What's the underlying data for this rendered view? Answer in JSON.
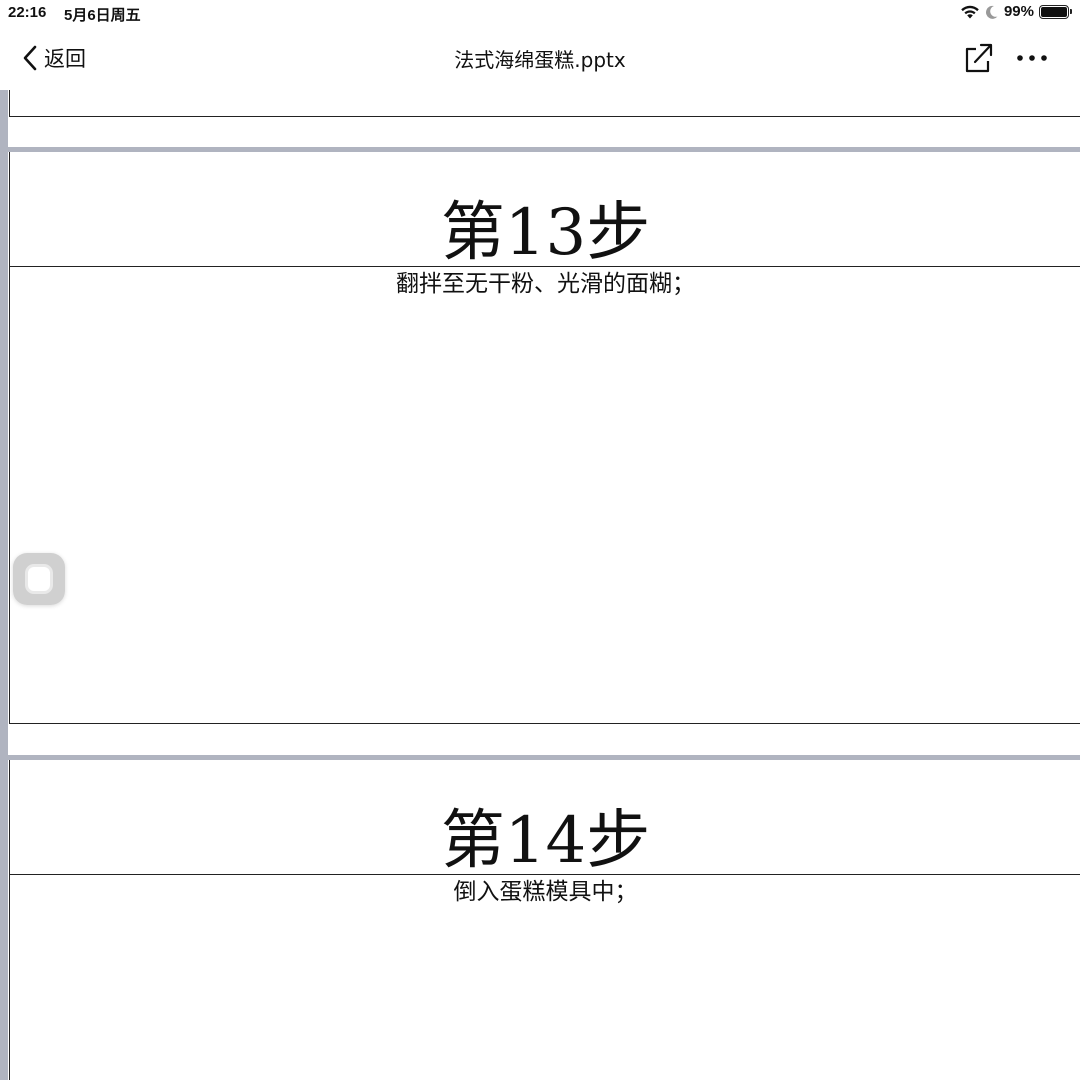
{
  "status_bar": {
    "time": "22:16",
    "date": "5月6日周五",
    "battery_percent_text": "99%",
    "battery_level": 0.99,
    "icons": [
      "wifi-icon",
      "moon-icon",
      "battery-icon"
    ]
  },
  "nav_bar": {
    "back_label": "返回",
    "title": "法式海绵蛋糕.pptx",
    "icons": [
      "chevron-left-icon",
      "share-icon",
      "more-icon"
    ]
  },
  "slides": [
    {
      "title": "第13步",
      "text": "翻拌至无干粉、光滑的面糊；"
    },
    {
      "title": "第14步",
      "text": "倒入蛋糕模具中；"
    }
  ],
  "colors": {
    "separator": "#b0b4c0",
    "border": "#222222",
    "background": "#ffffff"
  }
}
